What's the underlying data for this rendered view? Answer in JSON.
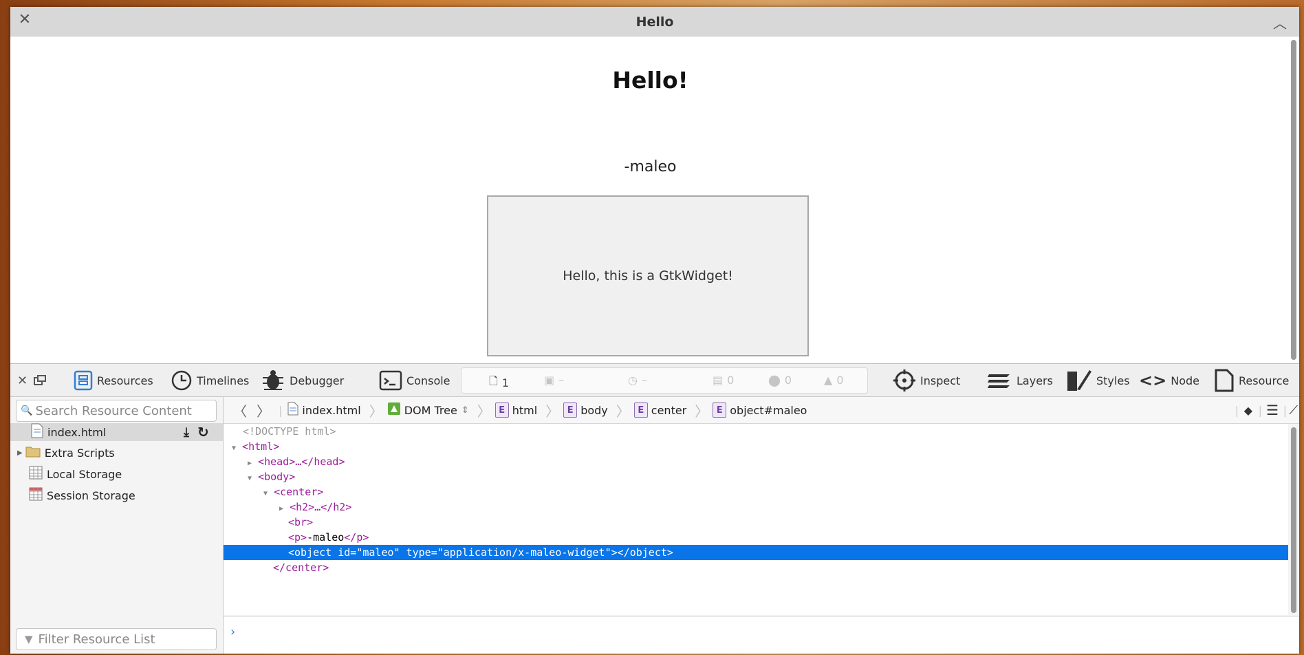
{
  "window": {
    "title": "Hello"
  },
  "page": {
    "heading": "Hello!",
    "signature": "-maleo",
    "widget_text": "Hello, this is a GtkWidget!"
  },
  "toolbar": {
    "tabs": [
      "Resources",
      "Timelines",
      "Debugger",
      "Console"
    ],
    "dashboard": {
      "resources": "1",
      "size": "–",
      "time": "–",
      "logs": "0",
      "errors": "0",
      "warnings": "0"
    },
    "right_tabs": [
      "Inspect",
      "Layers",
      "Styles",
      "Node",
      "Resource"
    ]
  },
  "sidebar": {
    "search_placeholder": "Search Resource Content",
    "items": [
      "index.html",
      "Extra Scripts",
      "Local Storage",
      "Session Storage"
    ],
    "filter_placeholder": "Filter Resource List"
  },
  "breadcrumb": {
    "file": "index.html",
    "view": "DOM Tree",
    "elements": [
      "html",
      "body",
      "center",
      "object#maleo"
    ]
  },
  "dom": {
    "doctype": "<!DOCTYPE html>",
    "html_open": "<html>",
    "head": "<head>…</head>",
    "body_open": "<body>",
    "center_open": "<center>",
    "h2": "<h2>…</h2>",
    "br": "<br>",
    "p_open": "<p>",
    "p_text": "-maleo",
    "p_close": "</p>",
    "object_line": "<object id=\"maleo\" type=\"application/x-maleo-widget\"></object>",
    "center_close": "</center>"
  },
  "colors": {
    "selection": "#0a75e8",
    "accent": "#2f7fd6"
  }
}
